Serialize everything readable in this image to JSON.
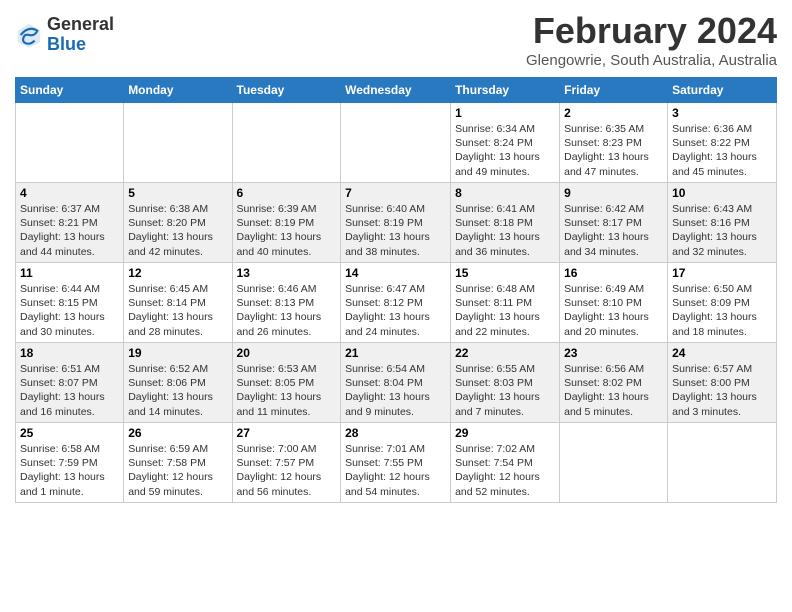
{
  "header": {
    "logo_general": "General",
    "logo_blue": "Blue",
    "month_title": "February 2024",
    "location": "Glengowrie, South Australia, Australia"
  },
  "days_of_week": [
    "Sunday",
    "Monday",
    "Tuesday",
    "Wednesday",
    "Thursday",
    "Friday",
    "Saturday"
  ],
  "weeks": [
    [
      {
        "day": "",
        "info": ""
      },
      {
        "day": "",
        "info": ""
      },
      {
        "day": "",
        "info": ""
      },
      {
        "day": "",
        "info": ""
      },
      {
        "day": "1",
        "info": "Sunrise: 6:34 AM\nSunset: 8:24 PM\nDaylight: 13 hours and 49 minutes."
      },
      {
        "day": "2",
        "info": "Sunrise: 6:35 AM\nSunset: 8:23 PM\nDaylight: 13 hours and 47 minutes."
      },
      {
        "day": "3",
        "info": "Sunrise: 6:36 AM\nSunset: 8:22 PM\nDaylight: 13 hours and 45 minutes."
      }
    ],
    [
      {
        "day": "4",
        "info": "Sunrise: 6:37 AM\nSunset: 8:21 PM\nDaylight: 13 hours and 44 minutes."
      },
      {
        "day": "5",
        "info": "Sunrise: 6:38 AM\nSunset: 8:20 PM\nDaylight: 13 hours and 42 minutes."
      },
      {
        "day": "6",
        "info": "Sunrise: 6:39 AM\nSunset: 8:19 PM\nDaylight: 13 hours and 40 minutes."
      },
      {
        "day": "7",
        "info": "Sunrise: 6:40 AM\nSunset: 8:19 PM\nDaylight: 13 hours and 38 minutes."
      },
      {
        "day": "8",
        "info": "Sunrise: 6:41 AM\nSunset: 8:18 PM\nDaylight: 13 hours and 36 minutes."
      },
      {
        "day": "9",
        "info": "Sunrise: 6:42 AM\nSunset: 8:17 PM\nDaylight: 13 hours and 34 minutes."
      },
      {
        "day": "10",
        "info": "Sunrise: 6:43 AM\nSunset: 8:16 PM\nDaylight: 13 hours and 32 minutes."
      }
    ],
    [
      {
        "day": "11",
        "info": "Sunrise: 6:44 AM\nSunset: 8:15 PM\nDaylight: 13 hours and 30 minutes."
      },
      {
        "day": "12",
        "info": "Sunrise: 6:45 AM\nSunset: 8:14 PM\nDaylight: 13 hours and 28 minutes."
      },
      {
        "day": "13",
        "info": "Sunrise: 6:46 AM\nSunset: 8:13 PM\nDaylight: 13 hours and 26 minutes."
      },
      {
        "day": "14",
        "info": "Sunrise: 6:47 AM\nSunset: 8:12 PM\nDaylight: 13 hours and 24 minutes."
      },
      {
        "day": "15",
        "info": "Sunrise: 6:48 AM\nSunset: 8:11 PM\nDaylight: 13 hours and 22 minutes."
      },
      {
        "day": "16",
        "info": "Sunrise: 6:49 AM\nSunset: 8:10 PM\nDaylight: 13 hours and 20 minutes."
      },
      {
        "day": "17",
        "info": "Sunrise: 6:50 AM\nSunset: 8:09 PM\nDaylight: 13 hours and 18 minutes."
      }
    ],
    [
      {
        "day": "18",
        "info": "Sunrise: 6:51 AM\nSunset: 8:07 PM\nDaylight: 13 hours and 16 minutes."
      },
      {
        "day": "19",
        "info": "Sunrise: 6:52 AM\nSunset: 8:06 PM\nDaylight: 13 hours and 14 minutes."
      },
      {
        "day": "20",
        "info": "Sunrise: 6:53 AM\nSunset: 8:05 PM\nDaylight: 13 hours and 11 minutes."
      },
      {
        "day": "21",
        "info": "Sunrise: 6:54 AM\nSunset: 8:04 PM\nDaylight: 13 hours and 9 minutes."
      },
      {
        "day": "22",
        "info": "Sunrise: 6:55 AM\nSunset: 8:03 PM\nDaylight: 13 hours and 7 minutes."
      },
      {
        "day": "23",
        "info": "Sunrise: 6:56 AM\nSunset: 8:02 PM\nDaylight: 13 hours and 5 minutes."
      },
      {
        "day": "24",
        "info": "Sunrise: 6:57 AM\nSunset: 8:00 PM\nDaylight: 13 hours and 3 minutes."
      }
    ],
    [
      {
        "day": "25",
        "info": "Sunrise: 6:58 AM\nSunset: 7:59 PM\nDaylight: 13 hours and 1 minute."
      },
      {
        "day": "26",
        "info": "Sunrise: 6:59 AM\nSunset: 7:58 PM\nDaylight: 12 hours and 59 minutes."
      },
      {
        "day": "27",
        "info": "Sunrise: 7:00 AM\nSunset: 7:57 PM\nDaylight: 12 hours and 56 minutes."
      },
      {
        "day": "28",
        "info": "Sunrise: 7:01 AM\nSunset: 7:55 PM\nDaylight: 12 hours and 54 minutes."
      },
      {
        "day": "29",
        "info": "Sunrise: 7:02 AM\nSunset: 7:54 PM\nDaylight: 12 hours and 52 minutes."
      },
      {
        "day": "",
        "info": ""
      },
      {
        "day": "",
        "info": ""
      }
    ]
  ]
}
